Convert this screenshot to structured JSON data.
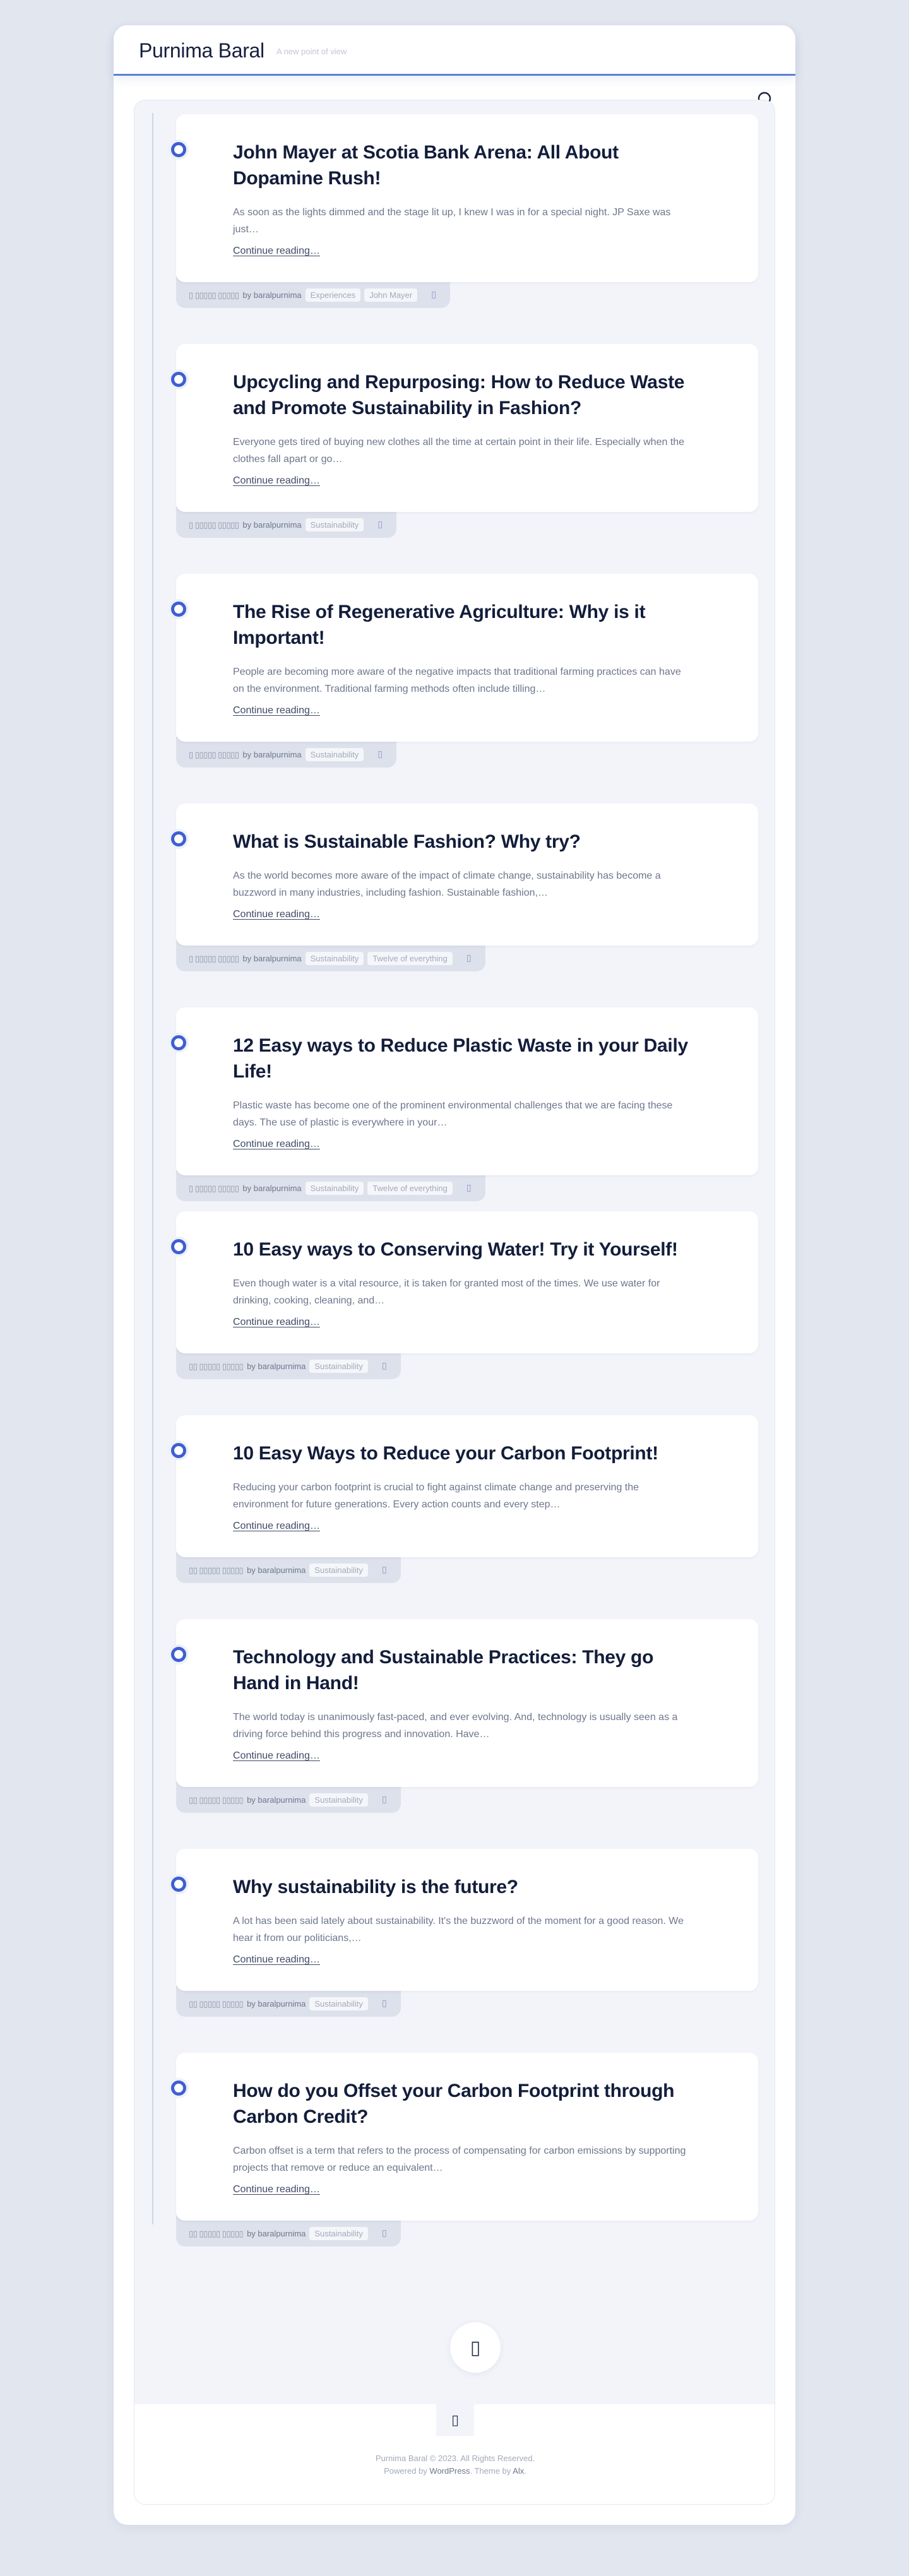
{
  "site": {
    "title": "Purnima Baral",
    "tagline": "A new point of view"
  },
  "posts": [
    {
      "title": "John Mayer at Scotia Bank Arena: All About Dopamine Rush!",
      "excerpt": "As soon as the lights dimmed and the stage lit up, I knew I was in for a special night. JP Saxe was just…",
      "more": "Continue reading…",
      "date": "▯ ▯▯▯▯▯ ▯▯▯▯▯",
      "author": "by baralpurnima",
      "tags": [
        "Experiences",
        "John Mayer"
      ],
      "comment_icon": "▯"
    },
    {
      "title": "Upcycling and Repurposing: How to Reduce Waste and Promote Sustainability in Fashion?",
      "excerpt": "Everyone gets tired of buying new clothes all the time at certain point in their life. Especially when the clothes fall apart or go…",
      "more": "Continue reading…",
      "date": "▯ ▯▯▯▯▯ ▯▯▯▯▯",
      "author": "by baralpurnima",
      "tags": [
        "Sustainability"
      ],
      "comment_icon": "▯"
    },
    {
      "title": "The Rise of Regenerative Agriculture: Why is it Important!",
      "excerpt": "People are becoming more aware of the negative impacts that traditional farming practices can have on the environment. Traditional farming methods often include tilling…",
      "more": "Continue reading…",
      "date": "▯ ▯▯▯▯▯ ▯▯▯▯▯",
      "author": "by baralpurnima",
      "tags": [
        "Sustainability"
      ],
      "comment_icon": "▯"
    },
    {
      "title": "What is Sustainable Fashion? Why try?",
      "excerpt": "As the world becomes more aware of the impact of climate change, sustainability has become a buzzword in many industries, including fashion. Sustainable fashion,…",
      "more": "Continue reading…",
      "date": "▯ ▯▯▯▯▯ ▯▯▯▯▯",
      "author": "by baralpurnima",
      "tags": [
        "Sustainability",
        "Twelve of everything"
      ],
      "comment_icon": "▯"
    },
    {
      "title": "12 Easy ways to Reduce Plastic Waste in your Daily Life!",
      "excerpt": "Plastic waste has become one of the prominent environmental challenges that we are facing these days. The use of plastic is everywhere in your…",
      "more": "Continue reading…",
      "date": "▯ ▯▯▯▯▯ ▯▯▯▯▯",
      "author": "by baralpurnima",
      "tags": [
        "Sustainability",
        "Twelve of everything"
      ],
      "comment_icon": "▯"
    },
    {
      "title": "10 Easy ways to Conserving Water! Try it Yourself!",
      "excerpt": "Even though water is a vital resource, it is taken for granted most of the times. We use water for drinking, cooking, cleaning, and…",
      "more": "Continue reading…",
      "date": "▯▯ ▯▯▯▯▯ ▯▯▯▯▯",
      "author": "by baralpurnima",
      "tags": [
        "Sustainability"
      ],
      "comment_icon": "▯"
    },
    {
      "title": "10 Easy Ways to Reduce your Carbon Footprint!",
      "excerpt": "Reducing your carbon footprint is crucial to fight against climate change and preserving the environment for future generations. Every action counts and every step…",
      "more": "Continue reading…",
      "date": "▯▯ ▯▯▯▯▯ ▯▯▯▯▯",
      "author": "by baralpurnima",
      "tags": [
        "Sustainability"
      ],
      "comment_icon": "▯"
    },
    {
      "title": "Technology and Sustainable Practices: They go Hand in Hand!",
      "excerpt": "The world today is unanimously fast-paced, and ever evolving. And, technology is usually seen as a driving force behind this progress and innovation. Have…",
      "more": "Continue reading…",
      "date": "▯▯ ▯▯▯▯▯ ▯▯▯▯▯",
      "author": "by baralpurnima",
      "tags": [
        "Sustainability"
      ],
      "comment_icon": "▯"
    },
    {
      "title": "Why sustainability is the future?",
      "excerpt": "A lot has been said lately about sustainability. It's the buzzword of the moment for a good reason. We hear it from our politicians,…",
      "more": "Continue reading…",
      "date": "▯▯ ▯▯▯▯▯ ▯▯▯▯▯",
      "author": "by baralpurnima",
      "tags": [
        "Sustainability"
      ],
      "comment_icon": "▯"
    },
    {
      "title": "How do you Offset your Carbon Footprint through Carbon Credit?",
      "excerpt": "Carbon offset is a term that refers to the process of compensating for carbon emissions by supporting projects that remove or reduce an equivalent…",
      "more": "Continue reading…",
      "date": "▯▯ ▯▯▯▯▯ ▯▯▯▯▯",
      "author": "by baralpurnima",
      "tags": [
        "Sustainability"
      ],
      "comment_icon": "▯"
    }
  ],
  "load_more_icon": "▯",
  "footer": {
    "icon": "▯",
    "copyright": "Purnima Baral © 2023. All Rights Reserved.",
    "powered_prefix": "Powered by ",
    "powered_link": "WordPress",
    "theme_prefix": ". Theme by ",
    "theme_link": "Alx",
    "theme_suffix": "."
  },
  "colors": {
    "accent": "#3e5fd0",
    "header_border": "#5b7fd6",
    "background": "#e2e6ef"
  }
}
